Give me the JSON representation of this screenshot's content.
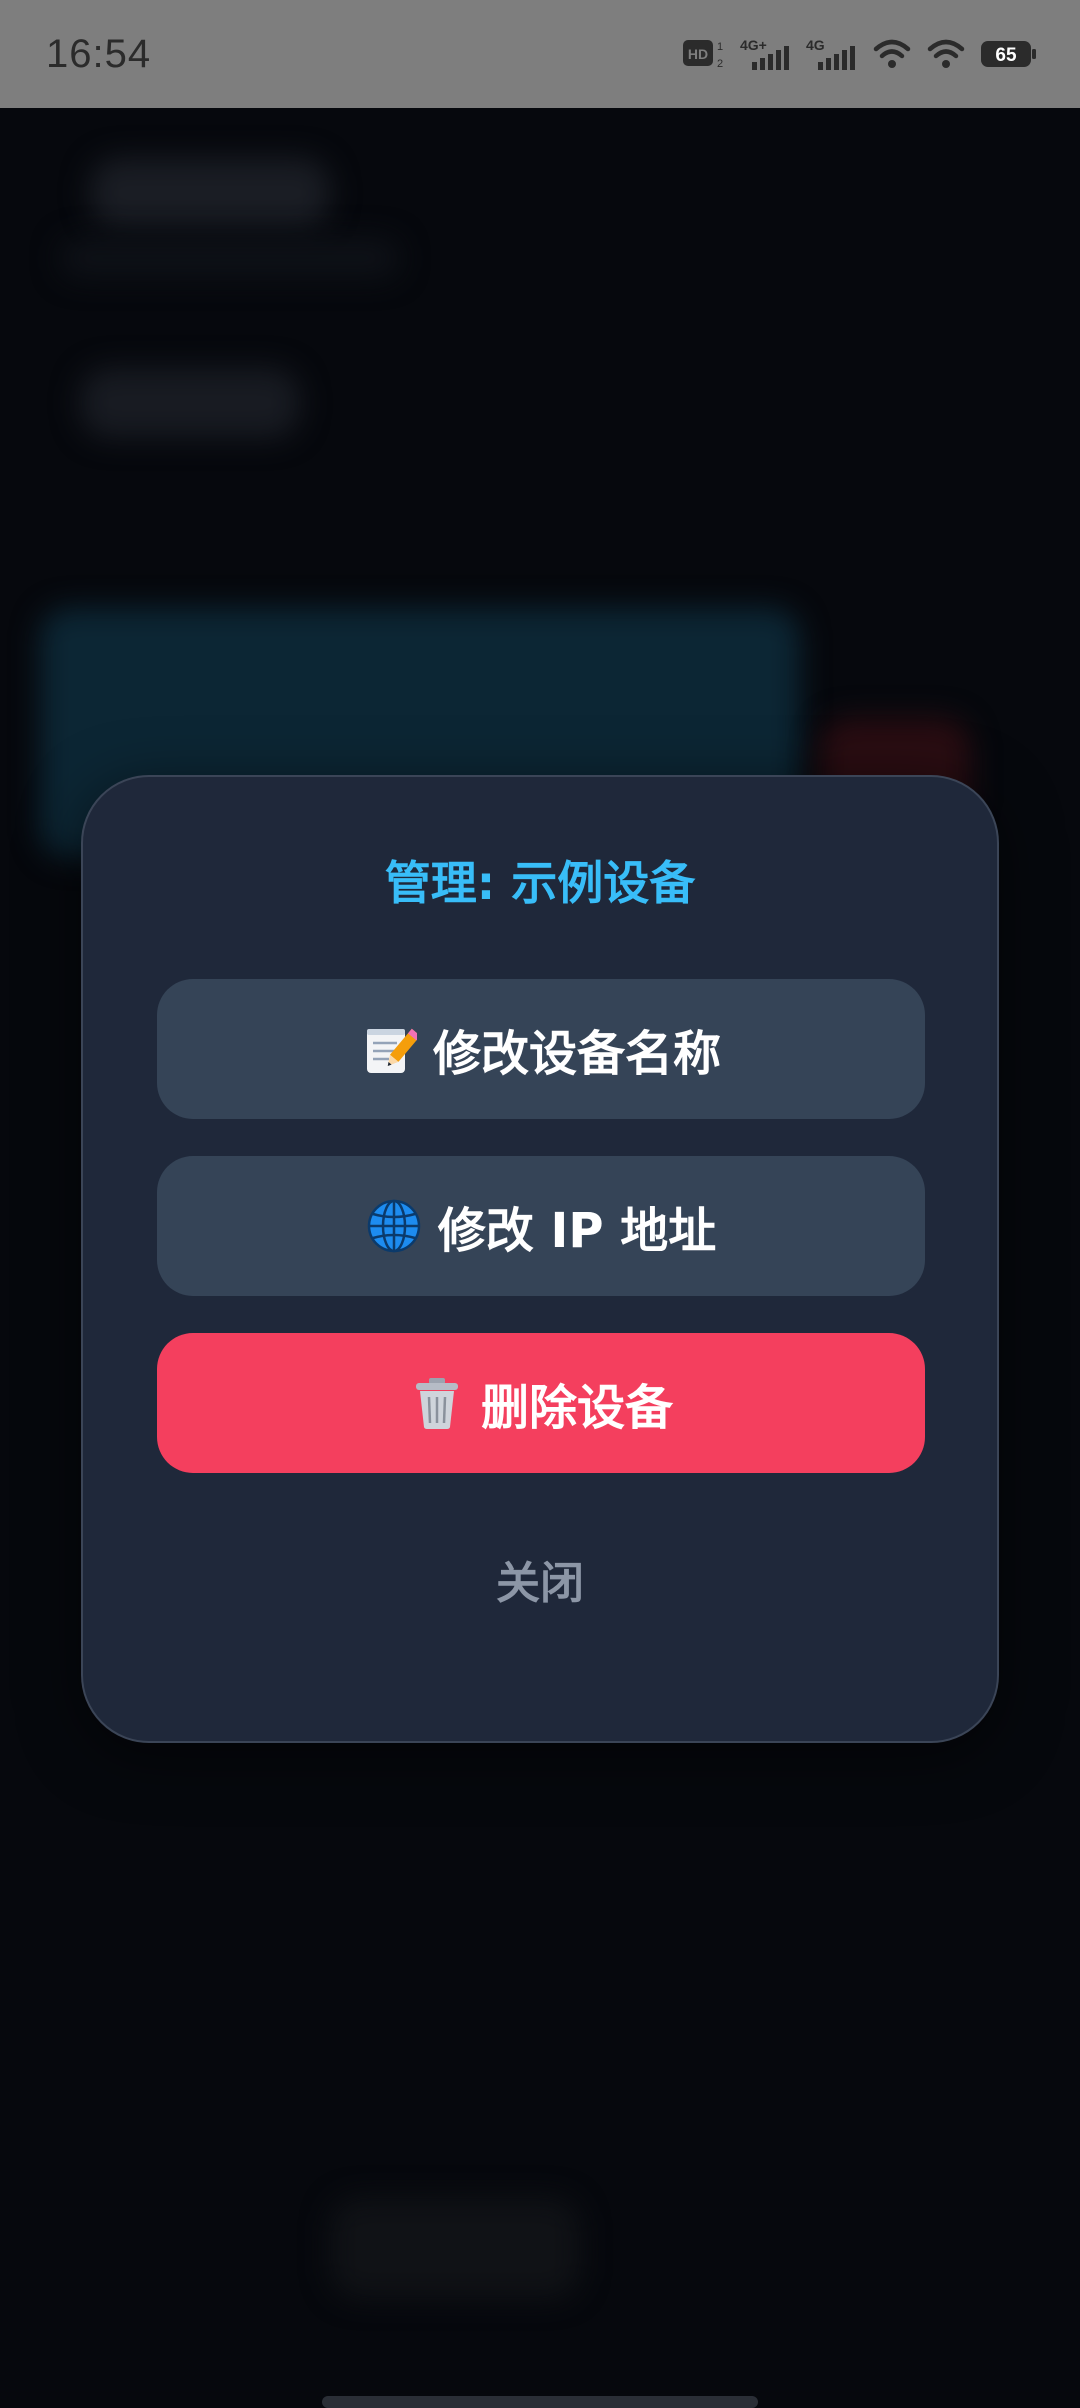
{
  "status_bar": {
    "time": "16:54",
    "hd_label": "HD",
    "net1_label": "4G+",
    "net2_label": "4G",
    "battery_level": "65"
  },
  "dialog": {
    "title": "管理: 示例设备",
    "rename_label": "修改设备名称",
    "ip_label": "修改 IP 地址",
    "delete_label": "删除设备",
    "close_label": "关闭"
  },
  "icons": {
    "rename": "memo-icon",
    "ip": "globe-icon",
    "delete": "trash-icon"
  },
  "colors": {
    "title": "#38bdf8",
    "button_gray": "#354457",
    "button_red": "#f43f5e",
    "dialog_bg": "#1f283a",
    "close_text": "#8c96a6"
  }
}
